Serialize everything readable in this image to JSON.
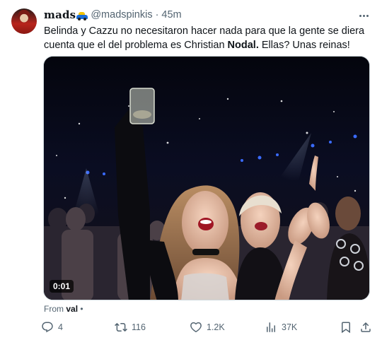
{
  "tweet": {
    "display_name": "mads",
    "name_emoji": "car-emoji",
    "handle": "@madspinkis",
    "separator": "·",
    "time": "45m",
    "text_part1": "Belinda y Cazzu no necesitaron hacer nada para que la gente se diera cuenta que el del problema es Christian ",
    "text_bold": "Nodal.",
    "text_part2": " Ellas? Unas reinas!",
    "video_duration": "0:01",
    "from_label": "From ",
    "from_source": "val",
    "from_suffix": " •"
  },
  "actions": {
    "replies": "4",
    "reposts": "116",
    "likes": "1.2K",
    "views": "37K"
  },
  "icons": {
    "reply": "reply-icon",
    "repost": "repost-icon",
    "like": "like-icon",
    "views": "views-icon",
    "bookmark": "bookmark-icon",
    "share": "share-icon",
    "more": "more-icon"
  },
  "colors": {
    "text_primary": "#0f1419",
    "text_secondary": "#536471",
    "border": "#cfd9de"
  }
}
